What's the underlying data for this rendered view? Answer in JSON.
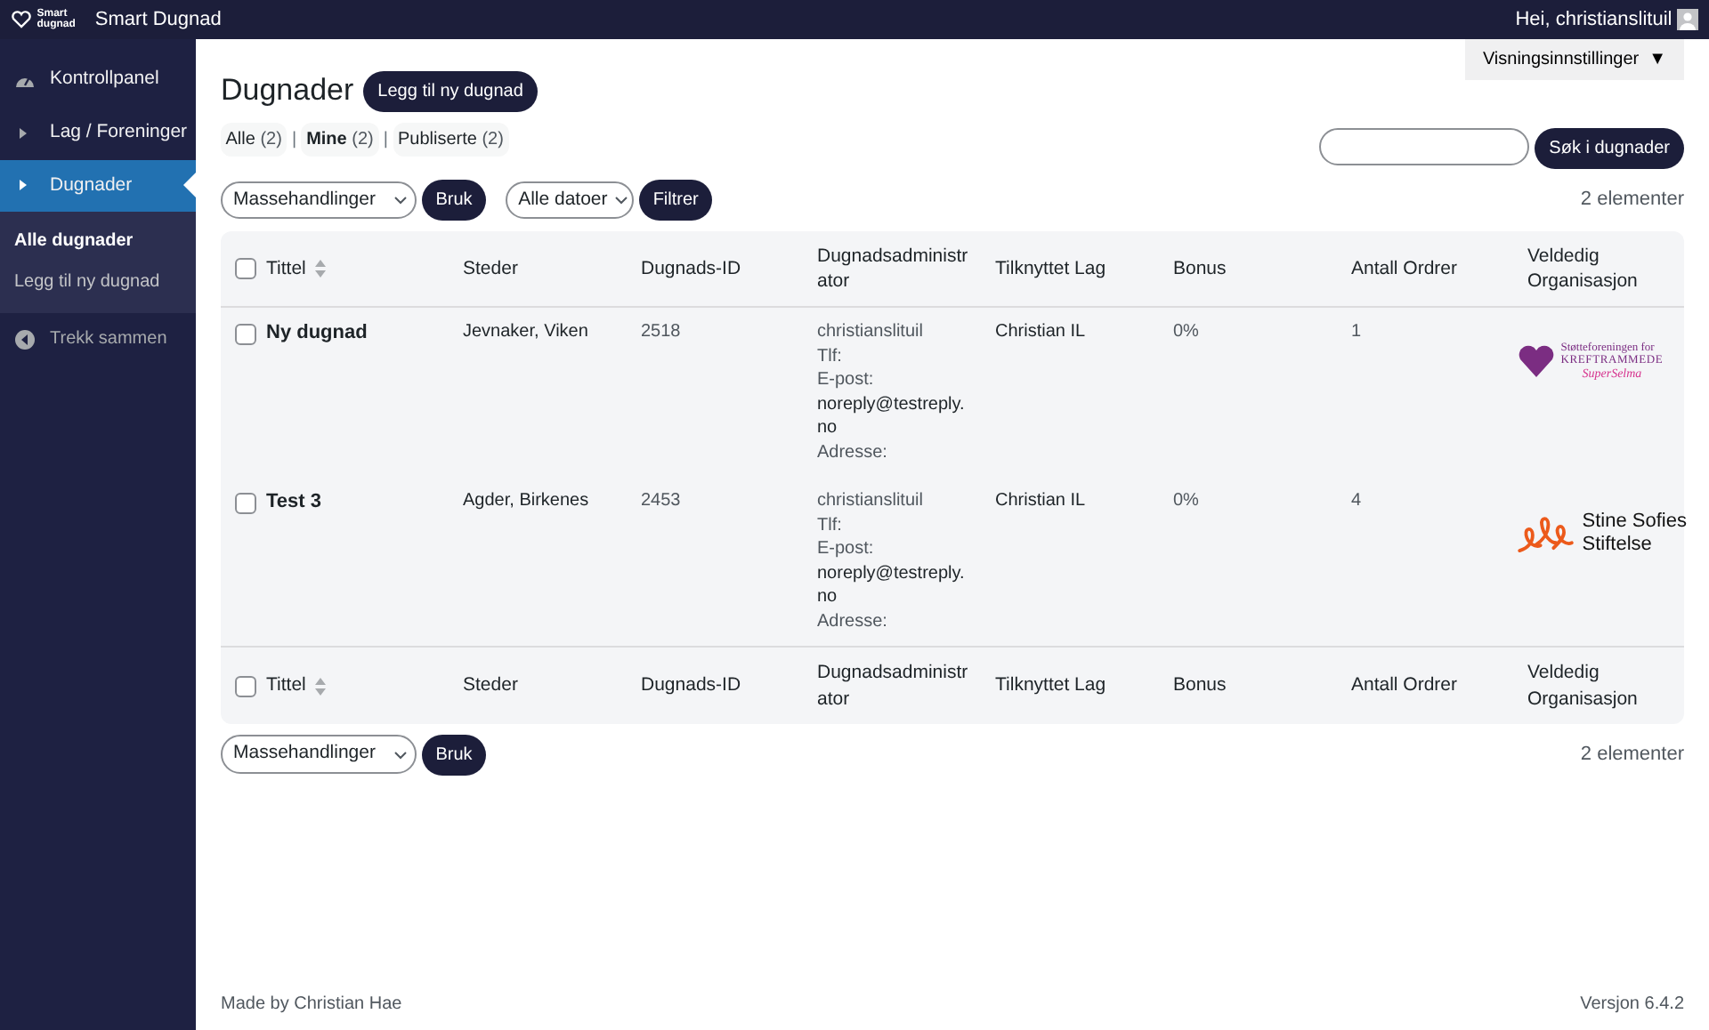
{
  "topbar": {
    "logo_text": [
      "Smart",
      "dugnad"
    ],
    "site_name": "Smart Dugnad",
    "greeting": "Hei, christianslituil"
  },
  "sidebar": {
    "items": [
      {
        "label": "Kontrollpanel",
        "kind": "dashboard",
        "selected": false
      },
      {
        "label": "Lag / Foreninger",
        "kind": "arrow",
        "selected": false
      },
      {
        "label": "Dugnader",
        "kind": "arrow",
        "selected": true
      }
    ],
    "submenu": [
      {
        "label": "Alle dugnader",
        "selected": true
      },
      {
        "label": "Legg til ny dugnad",
        "selected": false
      }
    ],
    "collapse": "Trekk sammen"
  },
  "screen_options": {
    "label": "Visningsinnstillinger",
    "arrow": "▼"
  },
  "page_title": "Dugnader",
  "add_button": "Legg til ny dugnad",
  "filter_separator": "|",
  "filters": [
    {
      "label": "Alle",
      "count": "(2)",
      "selected": false
    },
    {
      "label": "Mine",
      "count": "(2)",
      "selected": true
    },
    {
      "label": "Publiserte",
      "count": "(2)",
      "selected": false
    }
  ],
  "search": {
    "button": "Søk i dugnader"
  },
  "bulk_top": {
    "select": "Massehandlinger",
    "apply": "Bruk"
  },
  "date_filter": {
    "select": "Alle datoer",
    "button": "Filtrer"
  },
  "count_top": "2 elementer",
  "table": {
    "header_checked": false,
    "footer_checked": false,
    "columns": [
      "Tittel",
      "Steder",
      "Dugnads-ID",
      "Dugnadsadministrator",
      "Tilknyttet Lag",
      "Bonus",
      "Antall Ordrer",
      "Veldedig Organisasjon"
    ],
    "rows": [
      {
        "checked": false,
        "title": "Ny dugnad",
        "place": "Jevnaker, Viken",
        "id": "2518",
        "admin": {
          "name": "christianslituil",
          "phone": "Tlf:",
          "email_label": "E-post:",
          "email": "noreply@testreply.no",
          "address": "Adresse:"
        },
        "team": "Christian IL",
        "bonus": "0%",
        "orders": "1",
        "org": {
          "kind": "heart",
          "lines": [
            "Støtteforeningen for",
            "KREFTRAMMEDE",
            "SuperSelma"
          ]
        }
      },
      {
        "checked": false,
        "title": "Test 3",
        "place": "Agder, Birkenes",
        "id": "2453",
        "admin": {
          "name": "christianslituil",
          "phone": "Tlf:",
          "email_label": "E-post:",
          "email": "noreply@testreply.no",
          "address": "Adresse:"
        },
        "team": "Christian IL",
        "bonus": "0%",
        "orders": "4",
        "org": {
          "kind": "figures",
          "lines": [
            "Stine Sofies",
            "Stiftelse"
          ]
        }
      }
    ],
    "footer_columns": [
      "Tittel",
      "Steder",
      "Dugnads-ID",
      "Dugnadsadministrator",
      "Tilknyttet Lag",
      "Bonus",
      "Antall Ordrer",
      "Veldedig Organisasjon"
    ]
  },
  "bulk_bottom": {
    "select": "Massehandlinger",
    "apply": "Bruk"
  },
  "count_bottom": "2 elementer",
  "footer": {
    "left": "Made by Christian Hae",
    "right": "Versjon 6.4.2"
  }
}
